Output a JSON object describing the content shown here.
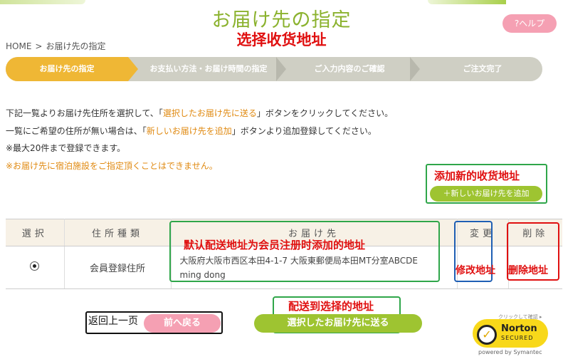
{
  "header": {
    "title": "お届け先の指定",
    "annotation_cn": "选择收货地址",
    "help_label": "?ヘルプ"
  },
  "breadcrumb": {
    "home": "HOME",
    "separator": ">",
    "current": "お届け先の指定"
  },
  "steps": [
    {
      "label": "お届け先の指定",
      "active": true
    },
    {
      "label": "お支払い方法・お届け時間の指定",
      "active": false
    },
    {
      "label": "ご入力内容のご確認",
      "active": false
    },
    {
      "label": "ご注文完了",
      "active": false
    }
  ],
  "instructions": {
    "line1_pre": "下記一覧よりお届け先住所を選択して、「",
    "line1_highlight": "選択したお届け先に送る",
    "line1_post": "」ボタンをクリックしてください。",
    "line2_pre": "一覧にご希望の住所が無い場合は、「",
    "line2_highlight": "新しいお届け先を追加",
    "line2_post": "」ボタンより追加登録してください。",
    "line3": "※最大20件まで登録できます。",
    "line4": "※お届け先に宿泊施設をご指定頂くことはできません。"
  },
  "add_address": {
    "annotation_cn": "添加新的收货地址",
    "button_label": "＋新しいお届け先を追加"
  },
  "table": {
    "headers": {
      "select": "選択",
      "type": "住所種類",
      "address": "お届け先",
      "edit": "変更",
      "delete": "削除"
    },
    "rows": [
      {
        "selected": true,
        "type": "会員登録住所",
        "address_line": "大阪府大阪市西区本田4-1-7 大阪東郵便局本田MT分室ABCDE",
        "name": "ming dong"
      }
    ],
    "address_annotation_cn": "默认配送地址为会员注册时添加的地址",
    "edit_annotation_cn": "修改地址",
    "delete_annotation_cn": "删除地址"
  },
  "footer": {
    "back_annotation_cn": "返回上一页",
    "back_label": "前へ戻る",
    "send_annotation_cn": "配送到选择的地址",
    "send_label": "選択したお届け先に送る"
  },
  "norton": {
    "top_text": "クリックして確認 ▸",
    "name": "Norton",
    "sub": "SECURED",
    "powered": "powered by Symantec"
  },
  "colors": {
    "accent_green": "#9ec431",
    "step_active": "#efb735",
    "help_pink": "#f5a0b3",
    "annotation_red": "#e01010",
    "box_green": "#2fa64a",
    "box_blue": "#1f5fb4"
  }
}
